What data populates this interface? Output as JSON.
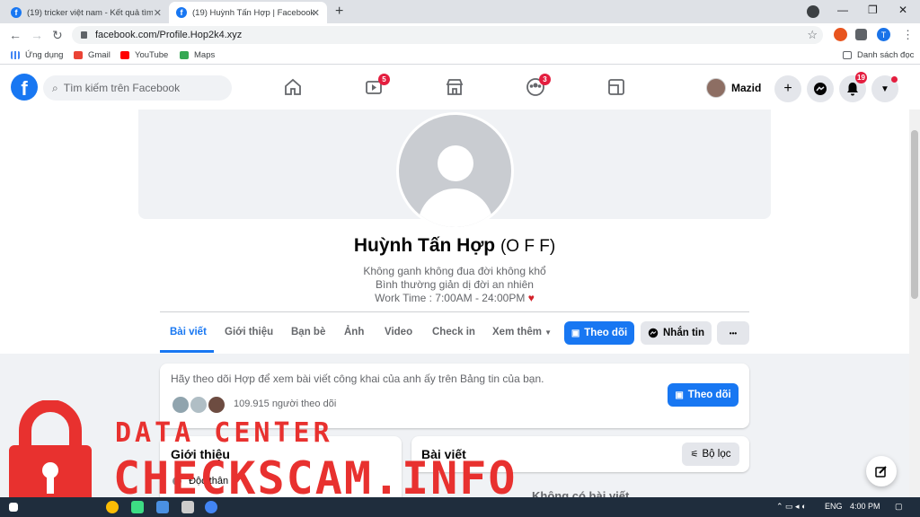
{
  "browser": {
    "tabs": [
      {
        "label": "(19) tricker việt nam - Kết quả tìm",
        "active": false
      },
      {
        "label": "(19) Huỳnh Tấn Hợp | Facebook",
        "active": true
      }
    ],
    "new_tab": "+",
    "url": "facebook.com/Profile.Hop2k4.xyz",
    "profile_letter": "T",
    "bookmarks": [
      "Ứng dụng",
      "Gmail",
      "YouTube",
      "Maps"
    ],
    "reading_list": "Danh sách đọc",
    "window_minimize": "—",
    "window_restore": "❐",
    "window_close": "✕",
    "tab_close": "✕"
  },
  "fbnav": {
    "logo": "f",
    "search_placeholder": "Tìm kiếm trên Facebook",
    "watch_badge": "5",
    "groups_badge": "3",
    "user_name": "Mazid",
    "notif_badge": "19",
    "plus": "+"
  },
  "profile": {
    "name": "Huỳnh Tấn Hợp",
    "alt_name": "(O F F)",
    "bio_lines": [
      "Không ganh không đua đời không khổ",
      "Bình thường giản dị đời an nhiên",
      "Work Time : 7:00AM - 24:00PM"
    ],
    "heart": "♥",
    "tabs": [
      "Bài viết",
      "Giới thiệu",
      "Bạn bè",
      "Ảnh",
      "Video",
      "Check in",
      "Xem thêm"
    ],
    "follow_button": "Theo dõi",
    "message_button": "Nhắn tin",
    "more_button": "•••"
  },
  "follow_card": {
    "text": "Hãy theo dõi Hợp để xem bài viết công khai của anh ấy trên Bảng tin của bạn.",
    "followers": "109.915 người theo dõi",
    "button": "Theo dõi"
  },
  "intro_card": {
    "title": "Giới thiệu",
    "item": "Độc thân"
  },
  "posts_card": {
    "title": "Bài viết",
    "filter": "Bộ lọc",
    "empty": "Không có bài viết"
  },
  "watermark": {
    "line1": "DATA CENTER",
    "line2": "CHECKSCAM.INFO"
  },
  "taskbar": {
    "lang": "ENG",
    "time": "4:00 PM"
  }
}
